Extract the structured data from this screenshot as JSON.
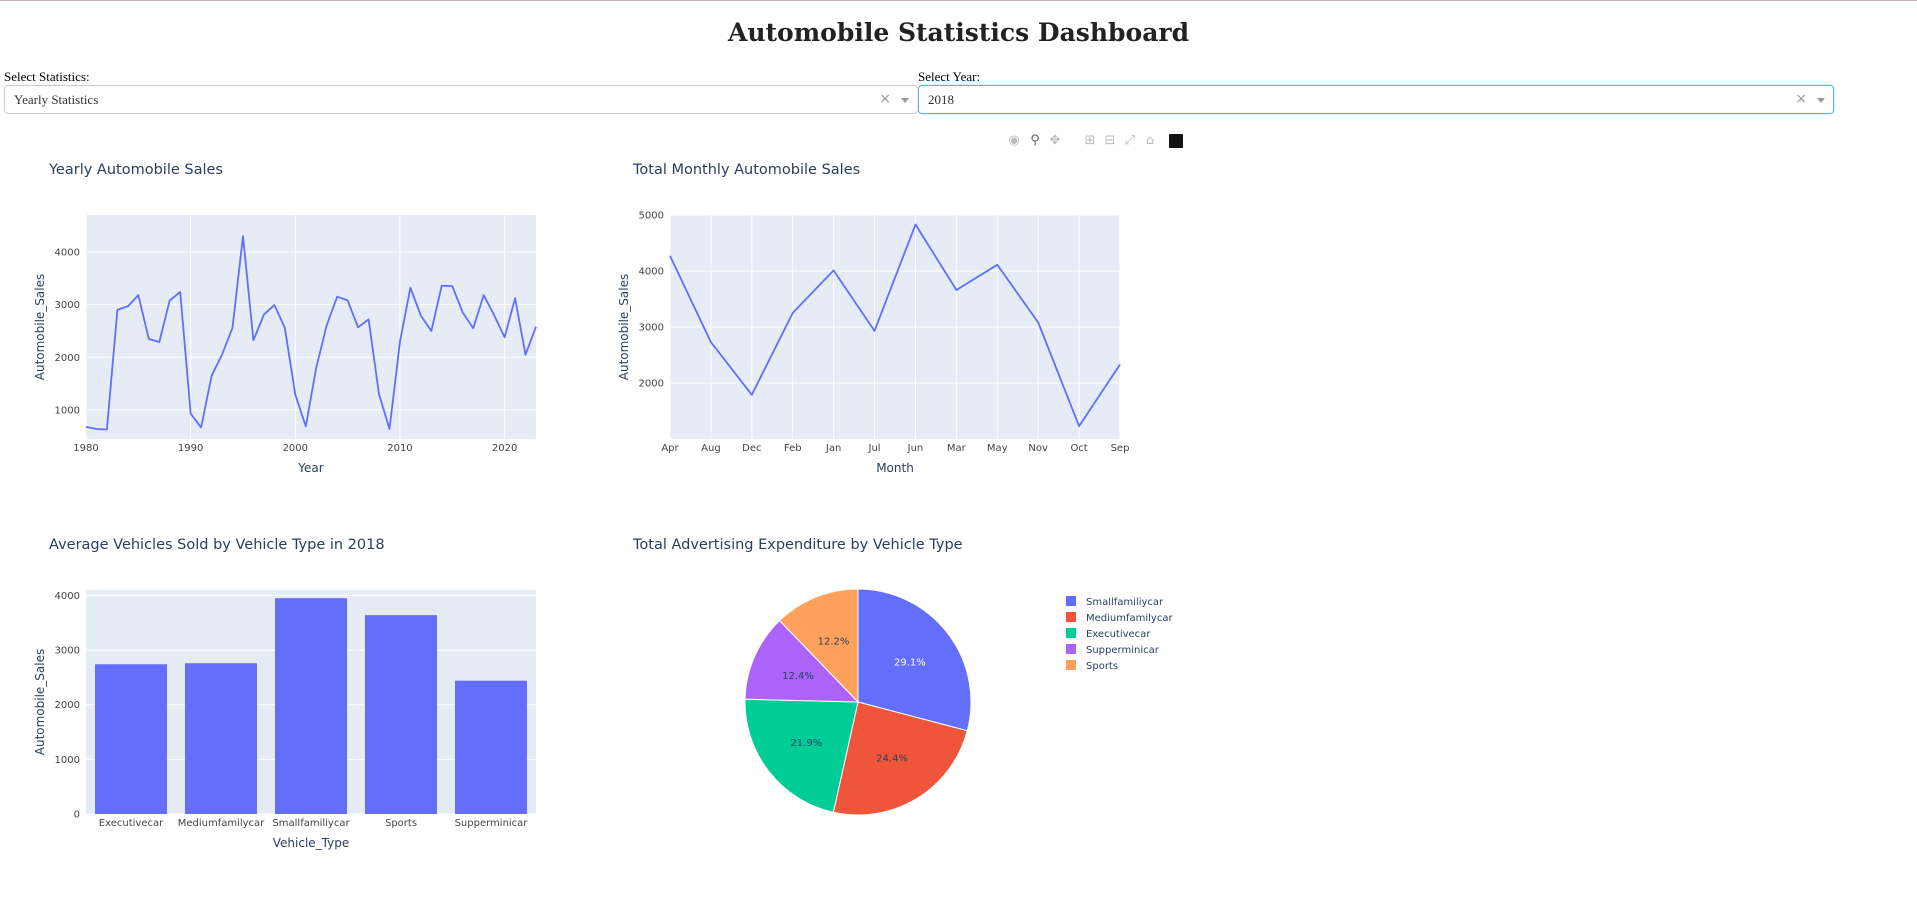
{
  "header": {
    "title": "Automobile Statistics Dashboard"
  },
  "controls": {
    "stat_label": "Select Statistics:",
    "stat_value": "Yearly Statistics",
    "year_label": "Select Year:",
    "year_value": "2018",
    "clear_glyph": "×"
  },
  "modebar": {
    "icons": [
      "camera-icon",
      "zoom-icon",
      "pan-icon",
      "zoom-in-icon",
      "zoom-out-icon",
      "autoscale-icon",
      "reset-axes-icon",
      "plotly-logo-icon"
    ]
  },
  "colors": {
    "line": "#636efa",
    "bar": "#636efa",
    "plot_bg": "#e5ecf6",
    "pie": [
      "#636efa",
      "#ef553b",
      "#00cc96",
      "#ab63fa",
      "#ffa15a"
    ]
  },
  "chart_data": [
    {
      "id": "yearly",
      "type": "line",
      "title": "Yearly Automobile Sales",
      "xlabel": "Year",
      "ylabel": "Automobile_Sales",
      "xlim": [
        1980,
        2023
      ],
      "ylim": [
        450,
        4700
      ],
      "xticks": [
        1980,
        1990,
        2000,
        2010,
        2020
      ],
      "xtick_labels": [
        "1980",
        "1990",
        "2000",
        "2010",
        "2020"
      ],
      "yticks": [
        1000,
        2000,
        3000,
        4000
      ],
      "ytick_labels": [
        "1000",
        "2000",
        "3000",
        "4000"
      ],
      "grid": true,
      "x": [
        1980,
        1981,
        1982,
        1983,
        1984,
        1985,
        1986,
        1987,
        1988,
        1989,
        1990,
        1991,
        1992,
        1993,
        1994,
        1995,
        1996,
        1997,
        1998,
        1999,
        2000,
        2001,
        2002,
        2003,
        2004,
        2005,
        2006,
        2007,
        2008,
        2009,
        2010,
        2011,
        2012,
        2013,
        2014,
        2015,
        2016,
        2017,
        2018,
        2019,
        2020,
        2021,
        2022,
        2023
      ],
      "y": [
        680,
        640,
        630,
        2900,
        2970,
        3180,
        2350,
        2290,
        3080,
        3240,
        930,
        670,
        1650,
        2050,
        2560,
        4300,
        2320,
        2810,
        2990,
        2560,
        1290,
        690,
        1800,
        2610,
        3150,
        3080,
        2570,
        2720,
        1300,
        640,
        2300,
        3320,
        2790,
        2500,
        3360,
        3350,
        2850,
        2550,
        3180,
        2800,
        2380,
        3120,
        2050,
        2580
      ]
    },
    {
      "id": "monthly",
      "type": "line",
      "title": "Total Monthly Automobile Sales",
      "xlabel": "Month",
      "ylabel": "Automobile_Sales",
      "ylim": [
        1000,
        5000
      ],
      "categories": [
        "Apr",
        "Aug",
        "Dec",
        "Feb",
        "Jan",
        "Jul",
        "Jun",
        "Mar",
        "May",
        "Nov",
        "Oct",
        "Sep"
      ],
      "yticks": [
        2000,
        3000,
        4000,
        5000
      ],
      "ytick_labels": [
        "2000",
        "3000",
        "4000",
        "5000"
      ],
      "grid": true,
      "values": [
        4270,
        2730,
        1790,
        3250,
        4010,
        2930,
        4830,
        3660,
        4110,
        3080,
        1230,
        2330
      ]
    },
    {
      "id": "vehicle-bar",
      "type": "bar",
      "title": "Average Vehicles Sold by Vehicle Type in 2018",
      "xlabel": "Vehicle_Type",
      "ylabel": "Automobile_Sales",
      "ylim": [
        0,
        4100
      ],
      "categories": [
        "Executivecar",
        "Mediumfamilycar",
        "Smallfamiliycar",
        "Sports",
        "Supperminicar"
      ],
      "yticks": [
        0,
        1000,
        2000,
        3000,
        4000
      ],
      "ytick_labels": [
        "0",
        "1000",
        "2000",
        "3000",
        "4000"
      ],
      "grid": true,
      "values": [
        2740,
        2760,
        3950,
        3640,
        2440
      ]
    },
    {
      "id": "ad-pie",
      "type": "pie",
      "title": "Total Advertising Expenditure by Vehicle Type",
      "labels": [
        "Smallfamiliycar",
        "Mediumfamilycar",
        "Executivecar",
        "Supperminicar",
        "Sports"
      ],
      "values": [
        29.1,
        24.4,
        21.9,
        12.4,
        12.2
      ],
      "value_labels": [
        "29.1%",
        "24.4%",
        "21.9%",
        "12.4%",
        "12.2%"
      ],
      "legend": "right"
    }
  ]
}
